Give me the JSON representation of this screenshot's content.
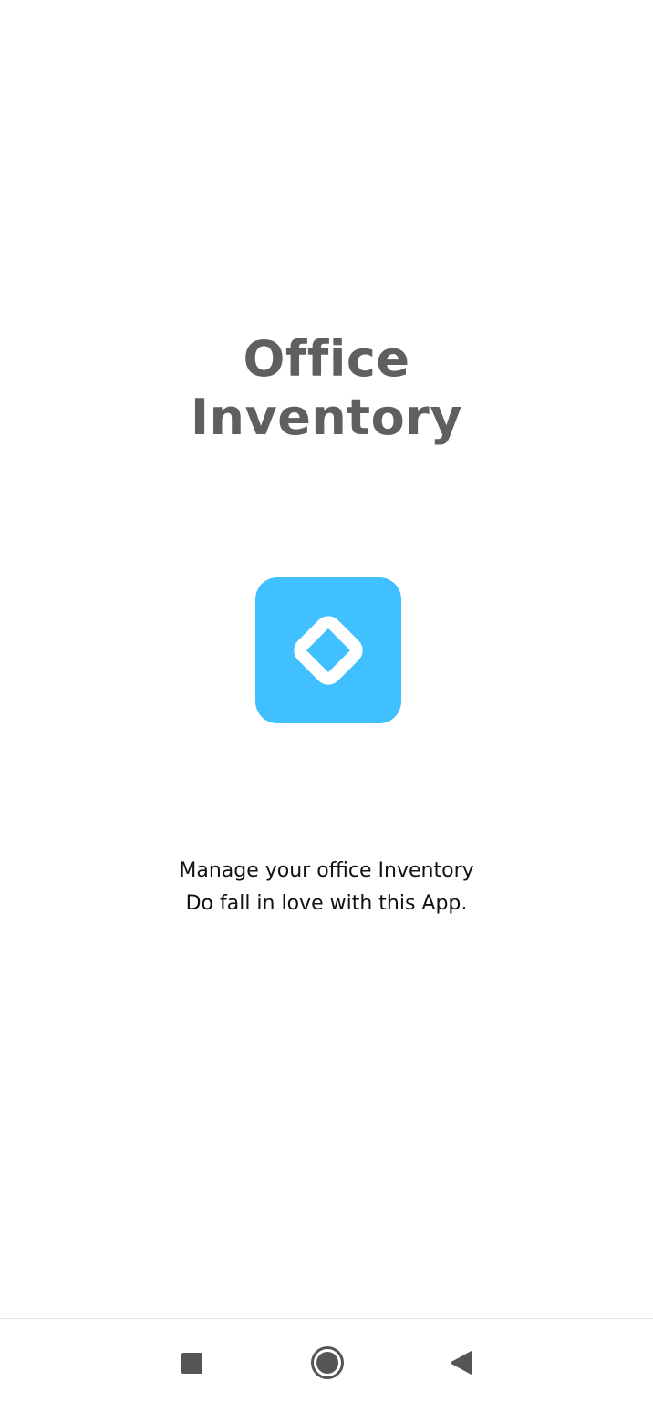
{
  "app": {
    "title_line1": "Office",
    "title_line2": "Inventory"
  },
  "logo": {
    "icon": "diamond-logo-icon",
    "color": "#40c0fe"
  },
  "tagline": {
    "line1": "Manage your office Inventory",
    "line2": "Do fall in love with this App."
  },
  "navbar": {
    "recents_icon": "square-recents-icon",
    "home_icon": "circle-home-icon",
    "back_icon": "triangle-back-icon"
  }
}
